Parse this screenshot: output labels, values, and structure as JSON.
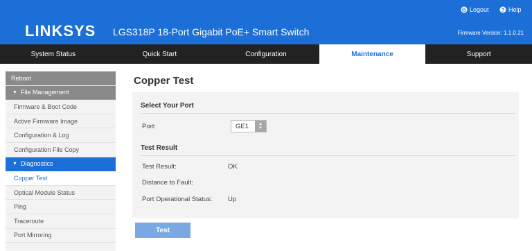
{
  "header": {
    "brand": "LINKSYS",
    "product_title": "LGS318P 18-Port Gigabit PoE+ Smart Switch",
    "logout_label": "Logout",
    "help_label": "Help",
    "firmware_version": "Firmware Version: 1.1.0.21",
    "accent_color": "#1d6fd8"
  },
  "nav": {
    "tabs": [
      {
        "label": "System Status"
      },
      {
        "label": "Quick Start"
      },
      {
        "label": "Configuration"
      },
      {
        "label": "Maintenance",
        "active": true
      },
      {
        "label": "Support"
      }
    ]
  },
  "sidebar": {
    "items": [
      {
        "label": "Reboot"
      },
      {
        "label": "File Management",
        "section": true
      },
      {
        "label": "Firmware & Boot Code"
      },
      {
        "label": "Active Firmware Image"
      },
      {
        "label": "Configuration & Log"
      },
      {
        "label": "Configuration File Copy"
      },
      {
        "label": "Diagnostics",
        "section": true,
        "expanded": true
      },
      {
        "label": "Copper Test",
        "active": true
      },
      {
        "label": "Optical Module Status"
      },
      {
        "label": "Ping"
      },
      {
        "label": "Traceroute"
      },
      {
        "label": "Port Mirroring"
      }
    ]
  },
  "main": {
    "title": "Copper Test",
    "select_port_heading": "Select Your Port",
    "port_label": "Port:",
    "port_value": "GE1",
    "test_result_heading": "Test Result",
    "rows": [
      {
        "label": "Test Result:",
        "value": "OK"
      },
      {
        "label": "Distance to Fault:",
        "value": ""
      },
      {
        "label": "Port Operational Status:",
        "value": "Up"
      }
    ],
    "test_button_label": "Test"
  }
}
